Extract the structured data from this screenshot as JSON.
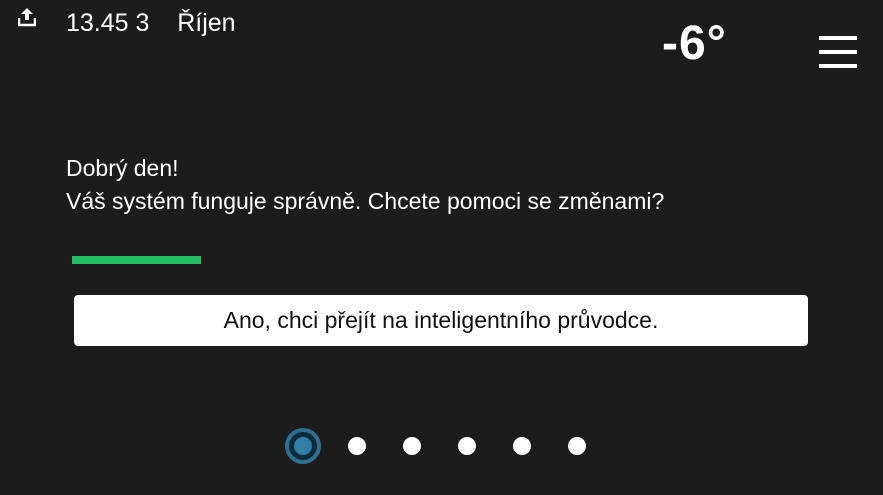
{
  "status_bar": {
    "icon": "upload-icon",
    "time": "13.45",
    "day": "3",
    "month": "Říjen",
    "temperature": "-6°",
    "menu_icon": "hamburger-menu-icon"
  },
  "main": {
    "greeting_line1": "Dobrý den!",
    "greeting_line2": "Váš systém funguje správně. Chcete pomoci se změnami?",
    "progress_fraction": 1.0,
    "progress_color": "#22c063",
    "wizard_button_label": "Ano, chci přejít na inteligentního průvodce."
  },
  "pager": {
    "count": 6,
    "active_index": 0,
    "active_color": "#2f7fa8"
  }
}
